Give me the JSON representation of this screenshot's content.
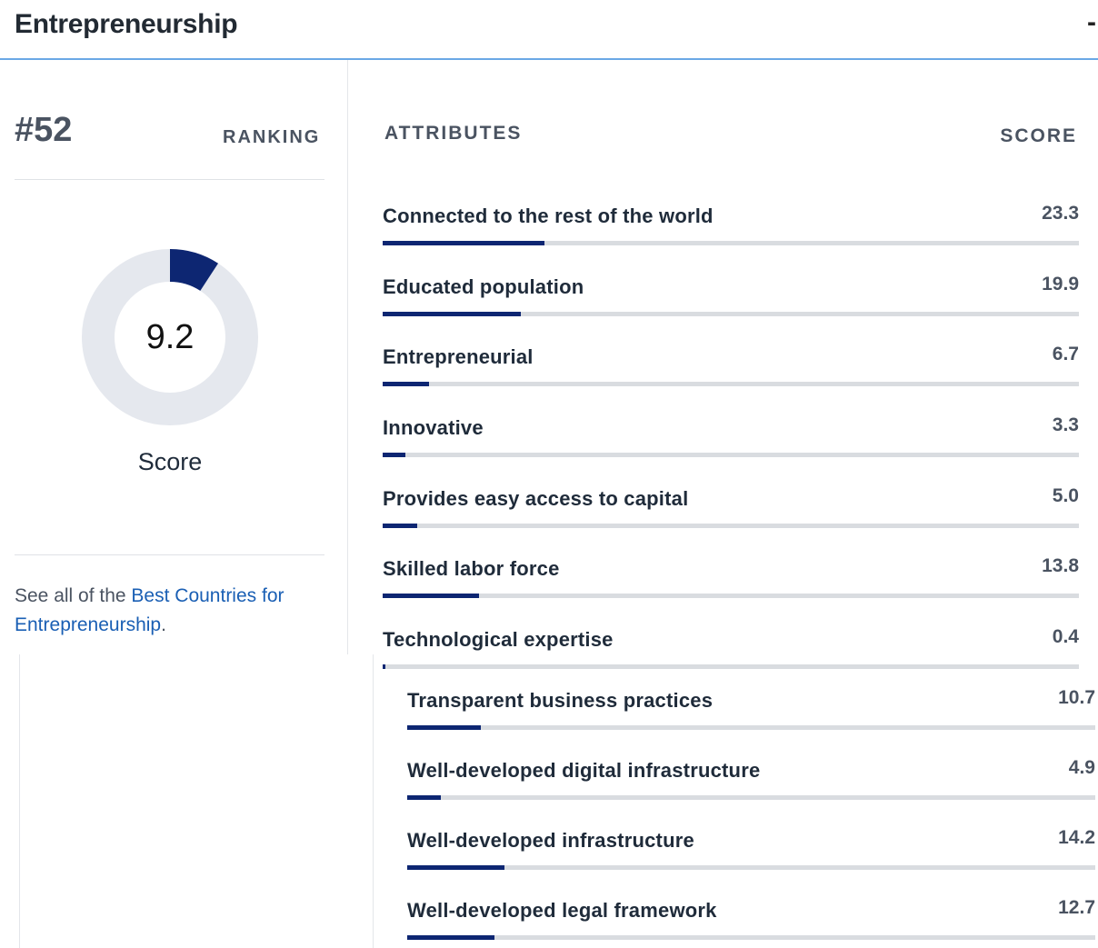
{
  "header": {
    "title": "Entrepreneurship",
    "toggle_glyph": "-"
  },
  "ranking": {
    "rank": "#52",
    "label": "RANKING"
  },
  "score": {
    "value": "9.2",
    "fraction": 0.092,
    "label": "Score"
  },
  "see_all": {
    "prefix": "See all of the ",
    "link_text": "Best Countries for Entrepreneurship",
    "suffix": "."
  },
  "attributes": {
    "header_label": "ATTRIBUTES",
    "score_label": "SCORE",
    "items": [
      {
        "name": "Connected to the rest of the world",
        "score": "23.3",
        "fraction": 0.233
      },
      {
        "name": "Educated population",
        "score": "19.9",
        "fraction": 0.199
      },
      {
        "name": "Entrepreneurial",
        "score": "6.7",
        "fraction": 0.067
      },
      {
        "name": "Innovative",
        "score": "3.3",
        "fraction": 0.033
      },
      {
        "name": "Provides easy access to capital",
        "score": "5.0",
        "fraction": 0.05
      },
      {
        "name": "Skilled labor force",
        "score": "13.8",
        "fraction": 0.138
      },
      {
        "name": "Technological expertise",
        "score": "0.4",
        "fraction": 0.004
      },
      {
        "name": "Transparent business practices",
        "score": "10.7",
        "fraction": 0.107
      },
      {
        "name": "Well-developed digital infrastructure",
        "score": "4.9",
        "fraction": 0.049
      },
      {
        "name": "Well-developed infrastructure",
        "score": "14.2",
        "fraction": 0.142
      },
      {
        "name": "Well-developed legal framework",
        "score": "12.7",
        "fraction": 0.127
      }
    ]
  },
  "colors": {
    "accent": "#0d2672",
    "track": "#d9dce0",
    "donut_track": "#e5e8ee",
    "link": "#1a5fb4",
    "header_rule": "#6aa8e6"
  }
}
